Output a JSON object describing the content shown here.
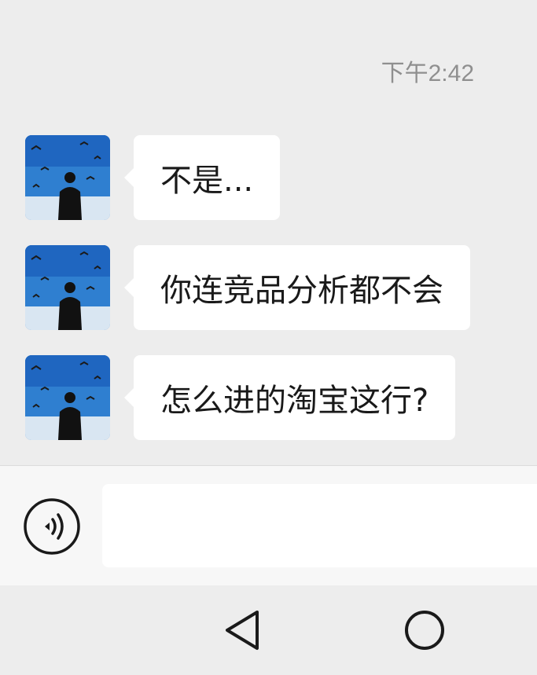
{
  "chat": {
    "timestamp": "下午2:42",
    "messages": [
      {
        "text": "不是..."
      },
      {
        "text": "你连竞品分析都不会"
      },
      {
        "text": "怎么进的淘宝这行?"
      }
    ]
  },
  "composer": {
    "value": "",
    "placeholder": "",
    "voice_icon": "voice-icon"
  },
  "nav": {
    "back_icon": "back-triangle-icon",
    "home_icon": "home-circle-icon"
  },
  "colors": {
    "background": "#ededed",
    "bubble": "#ffffff",
    "timestamp": "#8f8f8f"
  }
}
